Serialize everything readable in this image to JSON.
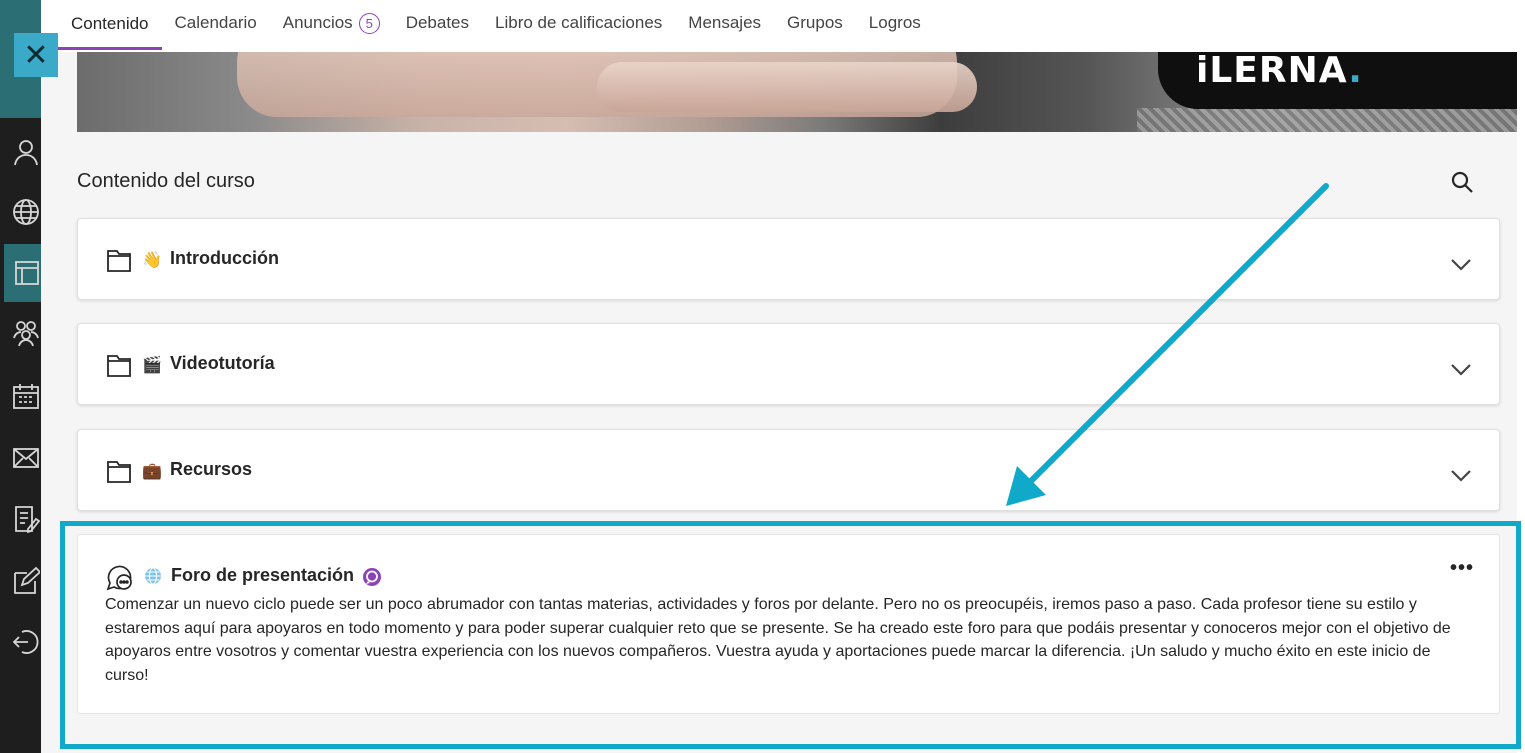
{
  "tabs": [
    {
      "label": "Contenido",
      "active": true
    },
    {
      "label": "Calendario"
    },
    {
      "label": "Anuncios",
      "badge": "5"
    },
    {
      "label": "Debates"
    },
    {
      "label": "Libro de calificaciones"
    },
    {
      "label": "Mensajes"
    },
    {
      "label": "Grupos"
    },
    {
      "label": "Logros"
    }
  ],
  "close": {
    "label": "✕"
  },
  "banner": {
    "logo_main": "iLERNA",
    "logo_dot": "."
  },
  "section": {
    "title": "Contenido del curso"
  },
  "folders": [
    {
      "emoji": "👋",
      "title": "Introducción"
    },
    {
      "emoji": "🎬",
      "title": "Videotutoría"
    },
    {
      "emoji": "💼",
      "title": "Recursos"
    }
  ],
  "forum": {
    "title": "Foro de presentación",
    "more": "•••",
    "description": "Comenzar un nuevo ciclo puede ser un poco abrumador con tantas materias, actividades y foros por delante. Pero no os preocupéis, iremos paso a paso. Cada profesor tiene su estilo y estaremos aquí para apoyaros en todo momento y para poder superar cualquier reto que se presente. Se ha creado este foro para que podáis presentar y conoceros mejor con el objetivo de apoyaros entre vosotros y comentar vuestra experiencia con los nuevos compañeros. Vuestra ayuda y aportaciones puede marcar la diferencia. ¡Un saludo y mucho éxito en este inicio de curso!"
  },
  "rail_icons": [
    "user-icon",
    "globe-icon",
    "courses-icon",
    "groups-icon",
    "calendar-icon",
    "mail-icon",
    "grades-icon",
    "edit-icon",
    "logout-icon"
  ],
  "colors": {
    "accent": "#8d43b8",
    "highlight": "#10a9c9",
    "rail": "#1e1e1e",
    "rail_active": "#2b6f75"
  }
}
